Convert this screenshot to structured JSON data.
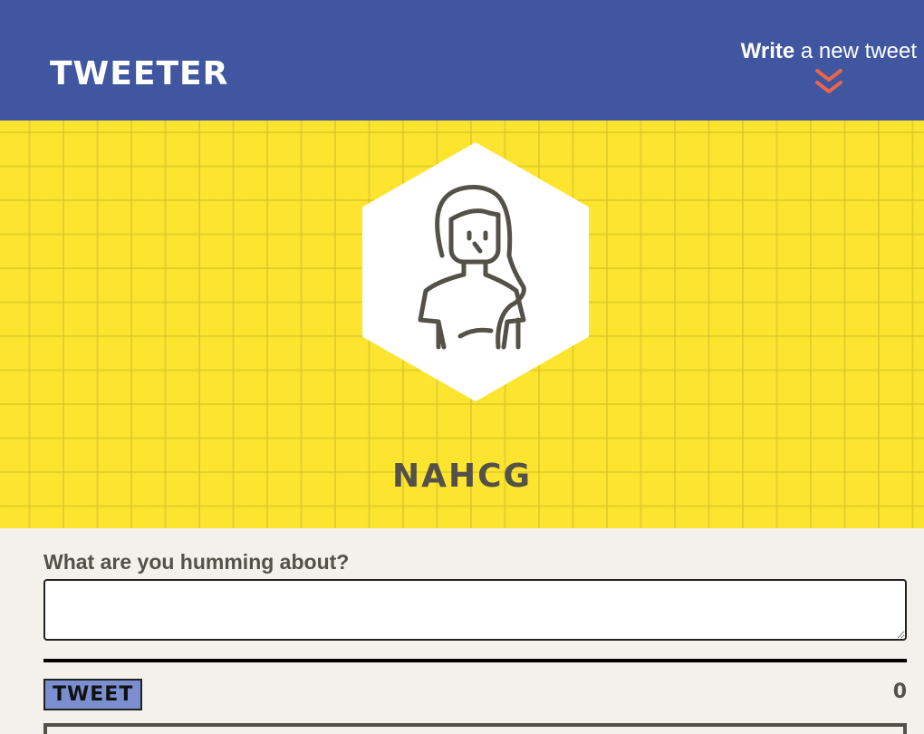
{
  "nav": {
    "brand": "TWEETER",
    "compose_bold": "Write",
    "compose_rest": " a new tweet",
    "compose_icon": "double-chevron-down-icon",
    "accent_color": "#e8664c",
    "background_color": "#4056a1"
  },
  "header": {
    "background_color": "#fde42f",
    "avatar_icon": "woman-avatar-icon",
    "handle": "NAHCG"
  },
  "compose_form": {
    "label": "What are you humming about?",
    "text_value": "",
    "button_label": "TWEET",
    "char_counter": "0"
  }
}
